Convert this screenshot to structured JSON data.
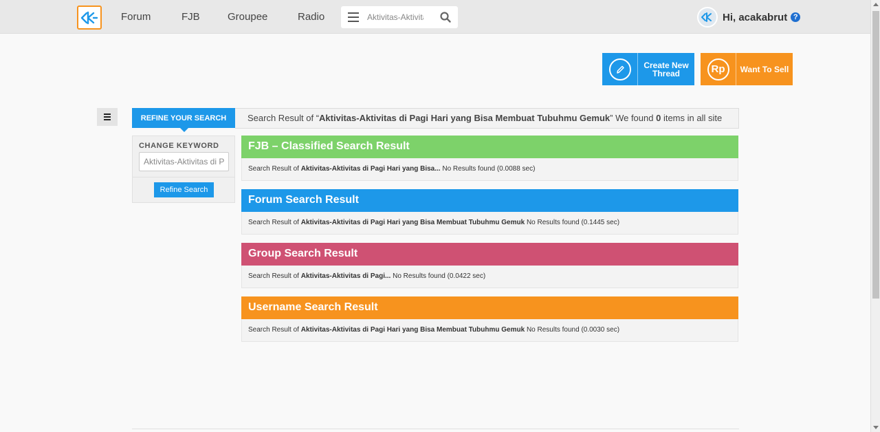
{
  "nav": {
    "logo_alt": "K",
    "links": [
      "Forum",
      "FJB",
      "Groupee",
      "Radio"
    ],
    "search_placeholder": "Aktivitas-Aktivitas di Pagi Hari yang Bisa Membuat Tubuhmu Gemuk",
    "user_greeting": "Hi, acakabrut",
    "help_glyph": "?"
  },
  "actions": {
    "create_label": "Create New Thread",
    "sell_label": "Want To Sell",
    "sell_icon_text": "Rp"
  },
  "refine": {
    "tab_label": "REFINE YOUR SEARCH",
    "change_keyword_label": "CHANGE KEYWORD",
    "keyword_value": "Aktivitas-Aktivitas di Pagi Hari yang Bisa Membuat Tubuhmu Gemuk",
    "button_label": "Refine Search"
  },
  "summary": {
    "prefix": "Search Result of “",
    "query": "Aktivitas-Aktivitas di Pagi Hari yang Bisa Membuat Tubuhmu Gemuk",
    "middle": "” We found ",
    "count": "0",
    "suffix": " items in all site"
  },
  "sections": [
    {
      "title": "FJB – Classified Search Result",
      "color": "#7dd26a",
      "prefix": "Search Result of ",
      "query": "Aktivitas-Aktivitas di Pagi Hari yang Bisa...",
      "status": " No Results found (0.0088 sec)"
    },
    {
      "title": "Forum Search Result",
      "color": "#1d98e9",
      "prefix": "Search Result of ",
      "query": "Aktivitas-Aktivitas di Pagi Hari yang Bisa Membuat Tubuhmu Gemuk",
      "status": " No Results found (0.1445 sec)"
    },
    {
      "title": "Group Search Result",
      "color": "#cf5173",
      "prefix": "Search Result of ",
      "query": "Aktivitas-Aktivitas di Pagi...",
      "status": " No Results found (0.0422 sec)"
    },
    {
      "title": "Username Search Result",
      "color": "#f7931e",
      "prefix": "Search Result of ",
      "query": "Aktivitas-Aktivitas di Pagi Hari yang Bisa Membuat Tubuhmu Gemuk",
      "status": " No Results found (0.0030 sec)"
    }
  ],
  "colors": {
    "brand_blue": "#1d98e9",
    "brand_orange": "#f7931e"
  }
}
